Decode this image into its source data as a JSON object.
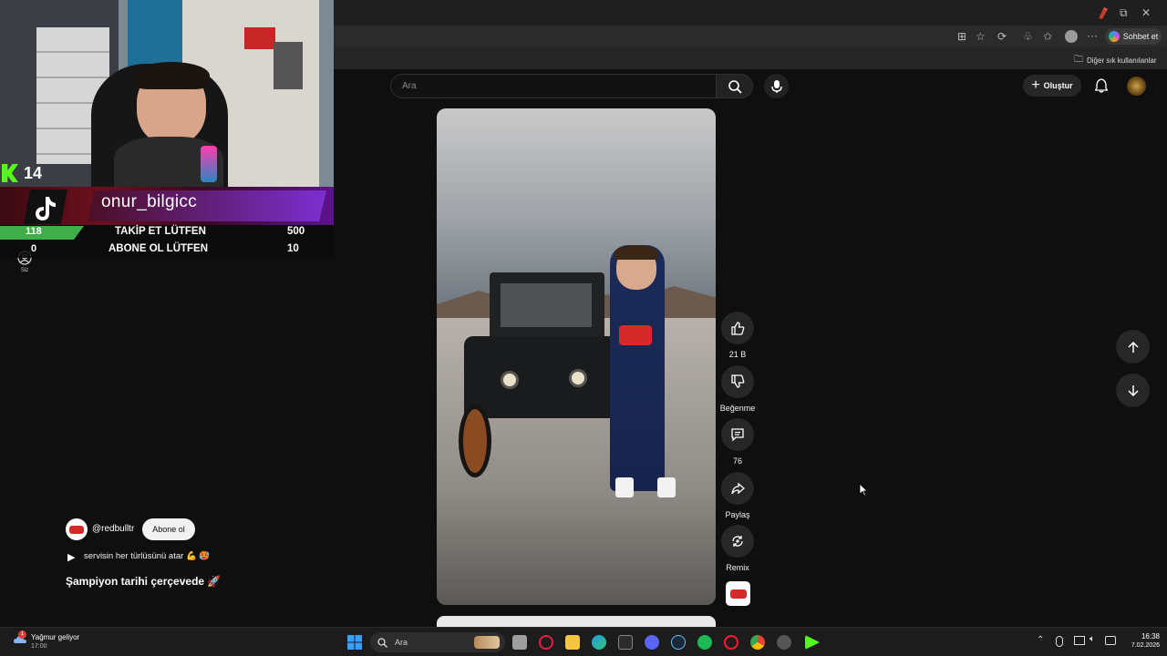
{
  "browser": {
    "copilot_label": "Sohbet et",
    "bookmarks_folder": "Diğer sık kullanılanlar"
  },
  "youtube": {
    "search_placeholder": "Ara",
    "create_label": "Oluştur",
    "sidebar_you_label": "Siz"
  },
  "stream_overlay": {
    "follower_badge": "14",
    "username": "onur_bilgicc",
    "goals": [
      {
        "current": "118",
        "label": "TAKİP ET LÜTFEN",
        "target": "500"
      },
      {
        "current": "0",
        "label": "ABONE OL LÜTFEN",
        "target": "10"
      }
    ]
  },
  "short": {
    "channel": "@redbulltr",
    "subscribe_label": "Abone ol",
    "audio_text": "servisin her türlüsünü atar 💪 🥵",
    "title": "Şampiyon tarihi çerçevede 🚀",
    "likes": "21 B",
    "dislike_label": "Beğenme",
    "comments": "76",
    "share_label": "Paylaş",
    "remix_label": "Remix"
  },
  "taskbar": {
    "weather_title": "Yağmur geliyor",
    "weather_sub": "17:00",
    "weather_badge": "1",
    "search_placeholder": "Ara",
    "time": "16:38",
    "date": "7.02.2026"
  },
  "colors": {
    "page_bg": "#0f0f0f",
    "goal_green": "#3fae49",
    "overlay_purple": "#7b2fd0",
    "kick_green": "#53fc18"
  }
}
